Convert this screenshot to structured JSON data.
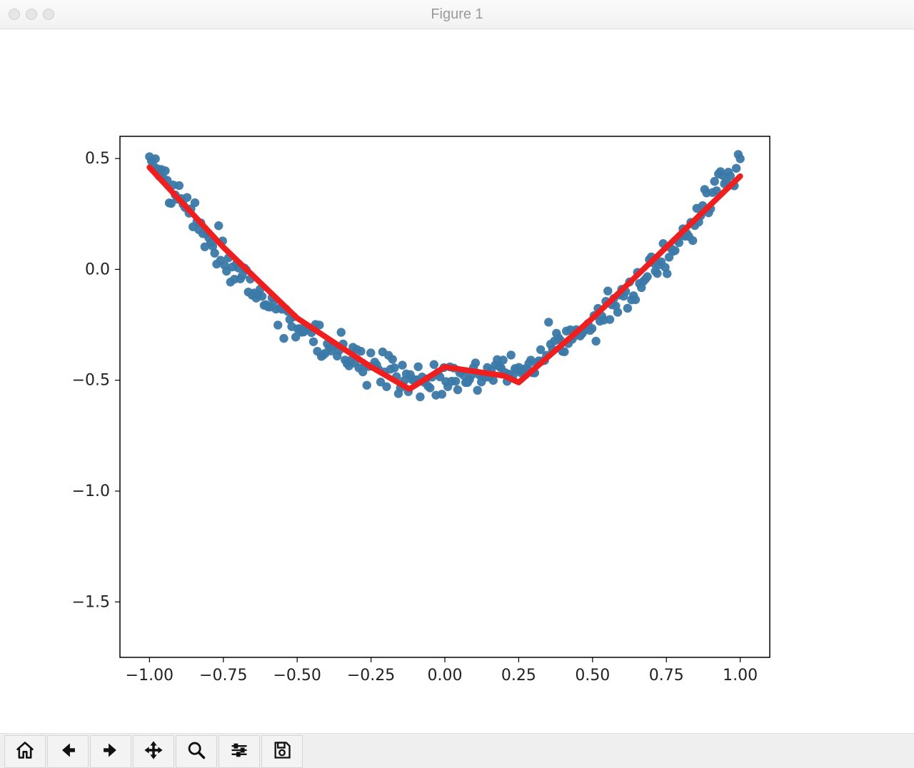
{
  "window": {
    "title": "Figure 1"
  },
  "toolbar": {
    "home": "Home",
    "back": "Back",
    "forward": "Forward",
    "pan": "Pan",
    "zoom": "Zoom",
    "configure": "Configure subplots",
    "save": "Save"
  },
  "chart_data": {
    "type": "scatter+line",
    "xlabel": "",
    "ylabel": "",
    "xlim": [
      -1.1,
      1.1
    ],
    "ylim": [
      -1.75,
      0.6
    ],
    "xticks": [
      "−1.00",
      "−0.75",
      "−0.50",
      "−0.25",
      "0.00",
      "0.25",
      "0.50",
      "0.75",
      "1.00"
    ],
    "yticks": [
      "0.5",
      "0.0",
      "−0.5",
      "−1.0",
      "−1.5"
    ],
    "colors": {
      "scatter": "#3b79a8",
      "line": "#ef1f1f",
      "axes": "#000000"
    },
    "series": [
      {
        "name": "scatter",
        "type": "scatter",
        "n_points": 300,
        "x_range": [
          -1.0,
          1.0
        ],
        "y_model": "y ≈ x^2 - 0.5 + noise(σ≈0.04)",
        "noise_sigma": 0.04
      },
      {
        "name": "fit",
        "type": "line",
        "x": [
          -1.0,
          -0.75,
          -0.5,
          -0.25,
          -0.12,
          0.0,
          0.2,
          0.25,
          0.5,
          0.75,
          1.0
        ],
        "y": [
          0.46,
          0.1,
          -0.22,
          -0.44,
          -0.54,
          -0.44,
          -0.48,
          -0.51,
          -0.22,
          0.1,
          0.42
        ]
      }
    ]
  }
}
